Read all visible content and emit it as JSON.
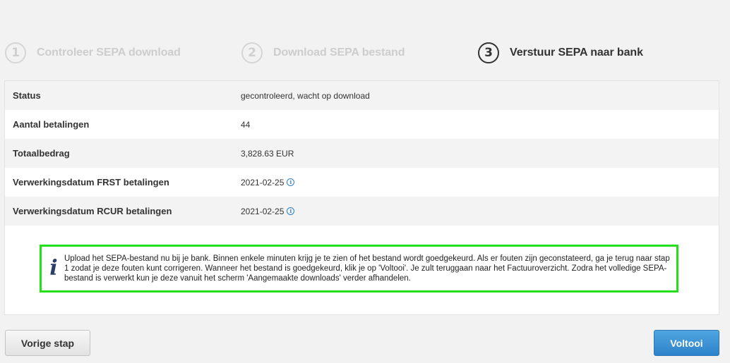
{
  "steps": [
    {
      "number": "1",
      "label": "Controleer SEPA download",
      "active": false
    },
    {
      "number": "2",
      "label": "Download SEPA bestand",
      "active": false
    },
    {
      "number": "3",
      "label": "Verstuur SEPA naar bank",
      "active": true
    }
  ],
  "details": [
    {
      "key": "Status",
      "value": "gecontroleerd, wacht op download",
      "info": false
    },
    {
      "key": "Aantal betalingen",
      "value": "44",
      "info": false
    },
    {
      "key": "Totaalbedrag",
      "value": "3,828.63 EUR",
      "info": false
    },
    {
      "key": "Verwerkingsdatum FRST betalingen",
      "value": "2021-02-25",
      "info": true
    },
    {
      "key": "Verwerkingsdatum RCUR betalingen",
      "value": "2021-02-25",
      "info": true
    }
  ],
  "notice": {
    "icon": "info-icon",
    "text": "Upload het SEPA-bestand nu bij je bank. Binnen enkele minuten krijg je te zien of het bestand wordt goedgekeurd. Als er fouten zijn geconstateerd, ga je terug naar stap 1 zodat je deze fouten kunt corrigeren. Wanneer het bestand is goedgekeurd, klik je op 'Voltooi'. Je zult teruggaan naar het Factuuroverzicht. Zodra het volledige SEPA-bestand is verwerkt kun je deze vanuit het scherm 'Aangemaakte downloads' verder afhandelen.",
    "border_color": "#22e01a"
  },
  "buttons": {
    "prev_label": "Vorige stap",
    "done_label": "Voltooi"
  },
  "colors": {
    "primary": "#2d83c9",
    "info": "#2a7fc8"
  }
}
